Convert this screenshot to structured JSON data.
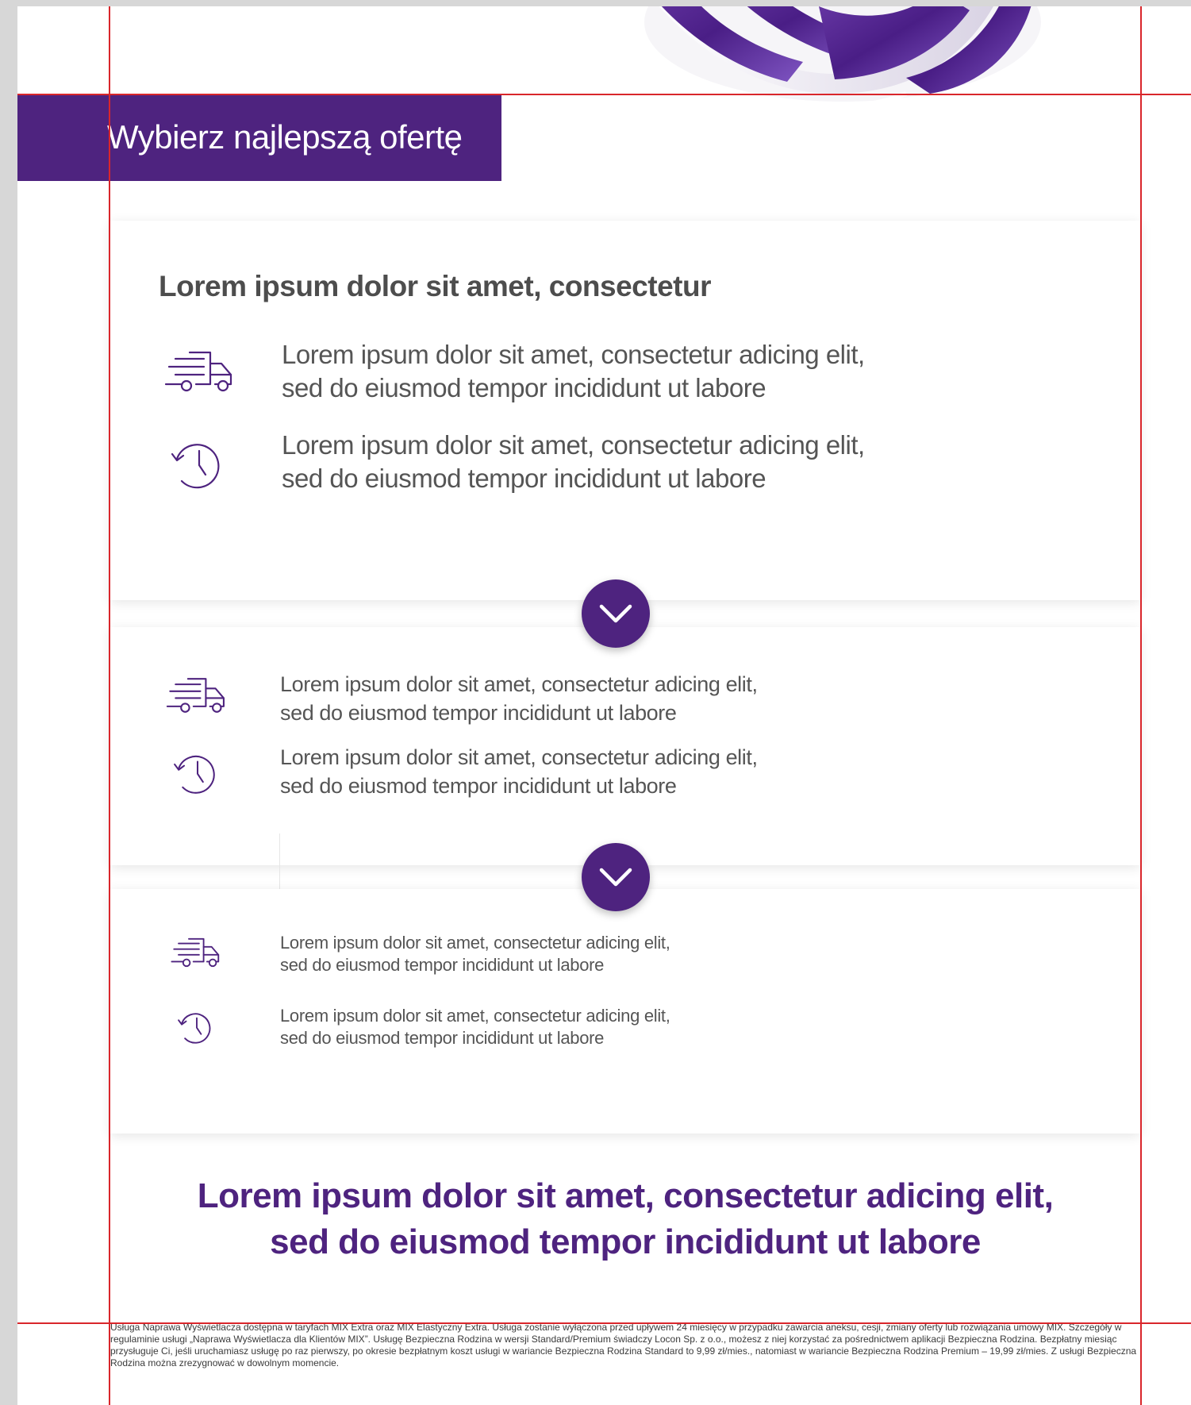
{
  "banner": {
    "title": "Wybierz najlepszą ofertę"
  },
  "card1": {
    "heading": "Lorem ipsum dolor sit amet, consectetur",
    "features": [
      {
        "icon": "delivery-truck-icon",
        "line1": "Lorem ipsum dolor sit amet, consectetur adicing elit,",
        "line2": "sed do eiusmod tempor incididunt ut labore"
      },
      {
        "icon": "history-clock-icon",
        "line1": "Lorem ipsum dolor sit amet, consectetur adicing elit,",
        "line2": "sed do eiusmod tempor incididunt ut labore"
      }
    ]
  },
  "card2": {
    "features": [
      {
        "icon": "delivery-truck-icon",
        "line1": "Lorem ipsum dolor sit amet, consectetur adicing elit,",
        "line2": "sed do eiusmod tempor incididunt ut labore"
      },
      {
        "icon": "history-clock-icon",
        "line1": "Lorem ipsum dolor sit amet, consectetur adicing elit,",
        "line2": "sed do eiusmod tempor incididunt ut labore"
      }
    ]
  },
  "card3": {
    "features": [
      {
        "icon": "delivery-truck-icon",
        "line1": "Lorem ipsum dolor sit amet, consectetur adicing elit,",
        "line2": "sed do eiusmod tempor incididunt ut labore"
      },
      {
        "icon": "history-clock-icon",
        "line1": "Lorem ipsum dolor sit amet, consectetur adicing elit,",
        "line2": "sed do eiusmod tempor incididunt ut labore"
      }
    ]
  },
  "cta": {
    "line1": "Lorem ipsum dolor sit amet, consectetur adicing elit,",
    "line2": "sed do eiusmod tempor incididunt ut labore"
  },
  "footer": {
    "text": "Usługa Naprawa Wyświetlacza dostępna w taryfach MIX Extra oraz MIX Elastyczny Extra. Usługa zostanie wyłączona przed upływem 24 miesięcy w przypadku zawarcia aneksu, cesji, zmiany oferty lub rozwiązania umowy MIX. Szczegóły w regulaminie usługi „Naprawa Wyświetlacza dla Klientów MIX”. Usługę Bezpieczna Rodzina w wersji Standard/Premium świadczy Locon Sp. z o.o., możesz z niej korzystać za pośrednictwem aplikacji Bezpieczna Rodzina. Bezpłatny miesiąc przysługuje Ci, jeśli uruchamiasz usługę po raz pierwszy, po okresie bezpłatnym koszt usługi w wariancie Bezpieczna Rodzina Standard to 9,99 zł/mies., natomiast w wariancie Bezpieczna Rodzina Premium – 19,99 zł/mies. Z usługi Bezpieczna Rodzina można zrezygnować w dowolnym momencie."
  },
  "icons": {
    "expand_buttons": "chevron-down-icon",
    "hero": "purple-ribbon-graphic"
  },
  "colors": {
    "brand_purple": "#4e237f",
    "guide_red": "#d9262b",
    "body_text": "#555555"
  }
}
